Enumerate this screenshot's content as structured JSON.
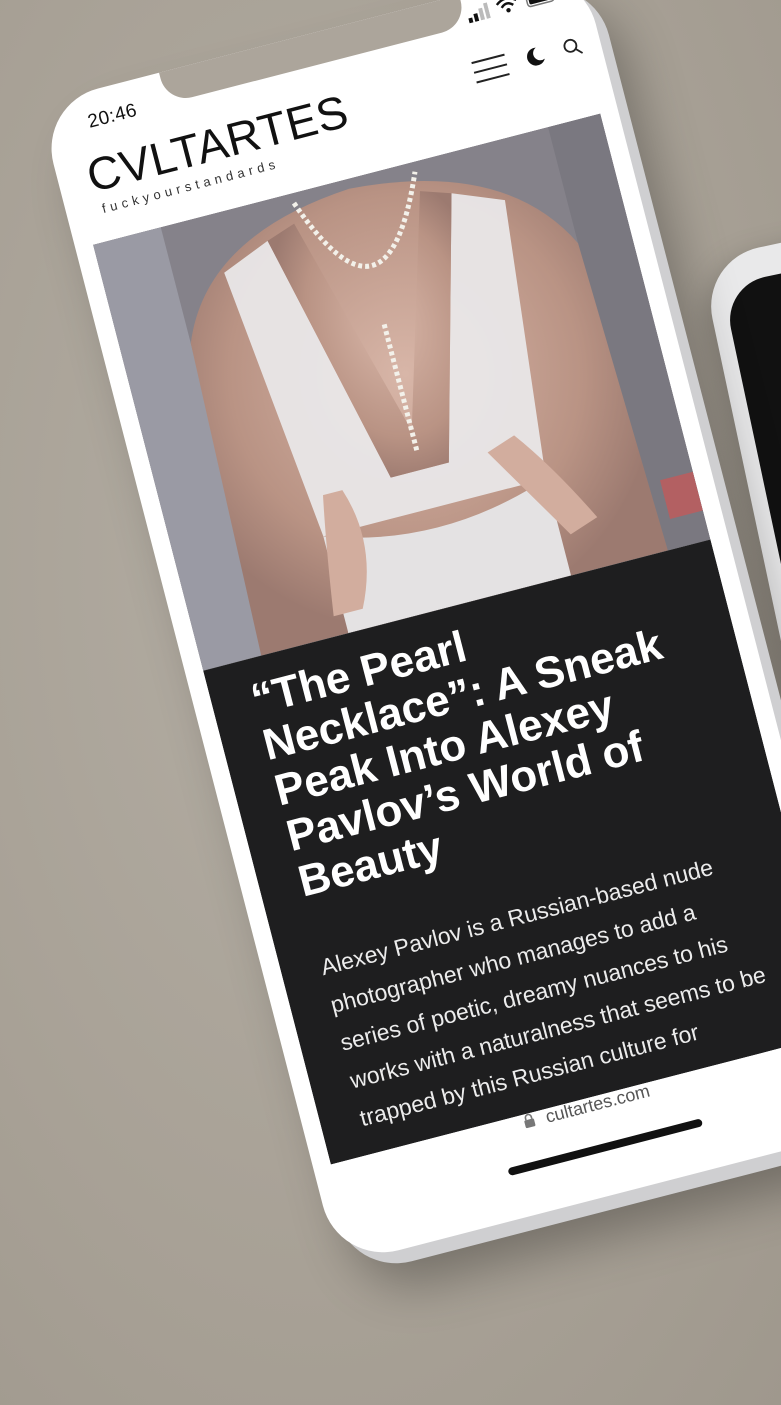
{
  "status_bar": {
    "time": "20:46"
  },
  "site": {
    "logo": "CVLTARTES",
    "tagline": "fuckyourstandards"
  },
  "header": {
    "icons": [
      "hamburger-icon",
      "moon-icon",
      "search-icon"
    ]
  },
  "article": {
    "headline": "“The Pearl Necklace”: A Sneak Peak Into Alexey Pavlov’s World of Beauty",
    "excerpt": "Alexey Pavlov is a Russian-based nude photographer who manages to add a series of poetic, dreamy nuances to his works with a naturalness that seems to be trapped by this Russian culture for"
  },
  "browser": {
    "url": "cultartes.com"
  },
  "colors": {
    "background": "#aca59b",
    "phone": "#ffffff",
    "article_bg": "#1e1e1f",
    "headline": "#ffffff",
    "excerpt": "#ececec"
  }
}
